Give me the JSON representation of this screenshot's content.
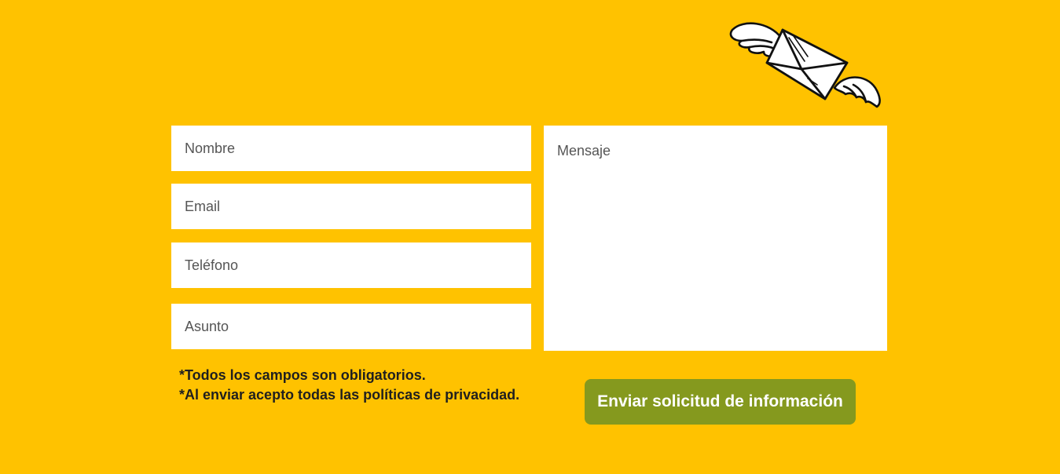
{
  "form": {
    "nombre_placeholder": "Nombre",
    "email_placeholder": "Email",
    "telefono_placeholder": "Teléfono",
    "asunto_placeholder": "Asunto",
    "mensaje_placeholder": "Mensaje",
    "submit_label": "Enviar solicitud de información"
  },
  "notes": {
    "required": "*Todos los campos son obligatorios.",
    "privacy": "*Al enviar acepto todas las políticas de privacidad."
  },
  "colors": {
    "background": "#FFC200",
    "button": "#85991E",
    "field": "#FFFFFF"
  },
  "icons": {
    "decoration": "flying-envelope-icon"
  }
}
